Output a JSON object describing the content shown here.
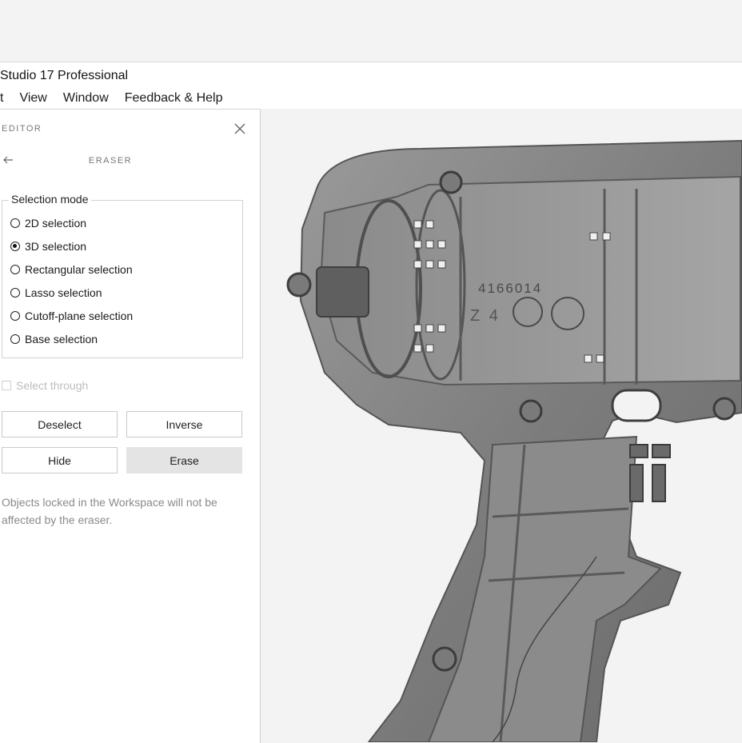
{
  "window": {
    "title": "Studio 17 Professional",
    "menu": [
      "t",
      "View",
      "Window",
      "Feedback & Help"
    ]
  },
  "panel": {
    "header": "EDITOR",
    "sub_header": "ERASER",
    "selection_mode": {
      "legend": "Selection mode",
      "options": [
        {
          "label": "2D selection",
          "selected": false
        },
        {
          "label": "3D selection",
          "selected": true
        },
        {
          "label": "Rectangular selection",
          "selected": false
        },
        {
          "label": "Lasso selection",
          "selected": false
        },
        {
          "label": "Cutoff-plane selection",
          "selected": false
        },
        {
          "label": "Base selection",
          "selected": false
        }
      ]
    },
    "select_through": {
      "label": "Select through",
      "checked": false,
      "enabled": false
    },
    "buttons": {
      "deselect": "Deselect",
      "inverse": "Inverse",
      "hide": "Hide",
      "erase": "Erase"
    },
    "note": "Objects locked in the Workspace will not be affected by the eraser."
  },
  "viewport": {
    "model_markings": {
      "part_number": "4166014",
      "code": "Z 4"
    }
  },
  "colors": {
    "background": "#f3f3f3",
    "panel": "#ffffff",
    "erase_button": "#e4e4e4",
    "model": "#8e8e8e"
  },
  "icons": {
    "close": "close-icon",
    "back": "back-arrow-icon"
  }
}
